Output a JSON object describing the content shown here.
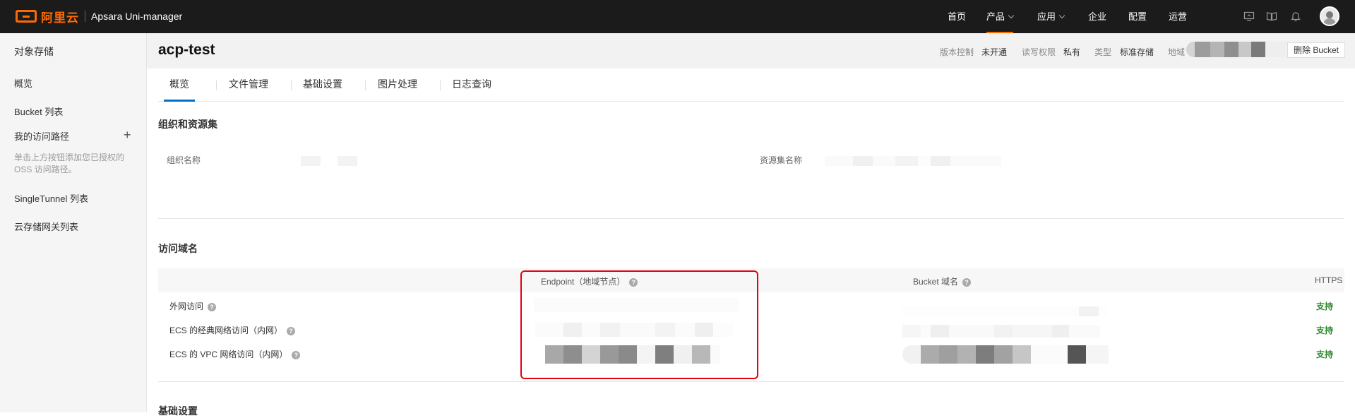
{
  "topbar": {
    "logo_text": "阿里云",
    "brand": "Apsara Uni-manager",
    "nav": [
      {
        "label": "首页"
      },
      {
        "label": "产品"
      },
      {
        "label": "应用"
      },
      {
        "label": "企业"
      },
      {
        "label": "配置"
      },
      {
        "label": "运营"
      }
    ],
    "icons": [
      "monitor-icon",
      "book-icon",
      "bell-icon",
      "user-avatar"
    ]
  },
  "sidebar": {
    "title": "对象存储",
    "items": [
      {
        "label": "概览"
      },
      {
        "label": "Bucket 列表"
      },
      {
        "label": "我的访问路径"
      },
      {
        "label": "SingleTunnel 列表"
      },
      {
        "label": "云存储网关列表"
      }
    ],
    "hint": "单击上方按钮添加您已授权的 OSS 访问路径。"
  },
  "header": {
    "bucket_name": "acp-test",
    "version_label": "版本控制",
    "version_value": "未开通",
    "acl_label": "读写权限",
    "acl_value": "私有",
    "type_label": "类型",
    "type_value": "标准存储",
    "region_label": "地域",
    "delete_button": "删除 Bucket"
  },
  "tabs": [
    {
      "label": "概览"
    },
    {
      "label": "文件管理"
    },
    {
      "label": "基础设置"
    },
    {
      "label": "图片处理"
    },
    {
      "label": "日志查询"
    }
  ],
  "org_section": {
    "title": "组织和资源集",
    "org_label": "组织名称",
    "resource_label": "资源集名称"
  },
  "domain_section": {
    "title": "访问域名",
    "col_endpoint": "Endpoint（地域节点）",
    "col_bucket": "Bucket 域名",
    "col_https": "HTTPS",
    "rows": [
      {
        "label": "外网访问",
        "https": "支持"
      },
      {
        "label": "ECS 的经典网络访问（内网）",
        "https": "支持"
      },
      {
        "label": "ECS 的 VPC 网络访问（内网）",
        "https": "支持"
      }
    ]
  },
  "basic_section": {
    "title": "基础设置"
  },
  "colors": {
    "topbar_bg": "#1b1b1b",
    "brand_orange": "#ff6a00",
    "active_tab": "#0070cc",
    "support_green": "#2e8b2e",
    "highlight_red": "#e60012"
  }
}
